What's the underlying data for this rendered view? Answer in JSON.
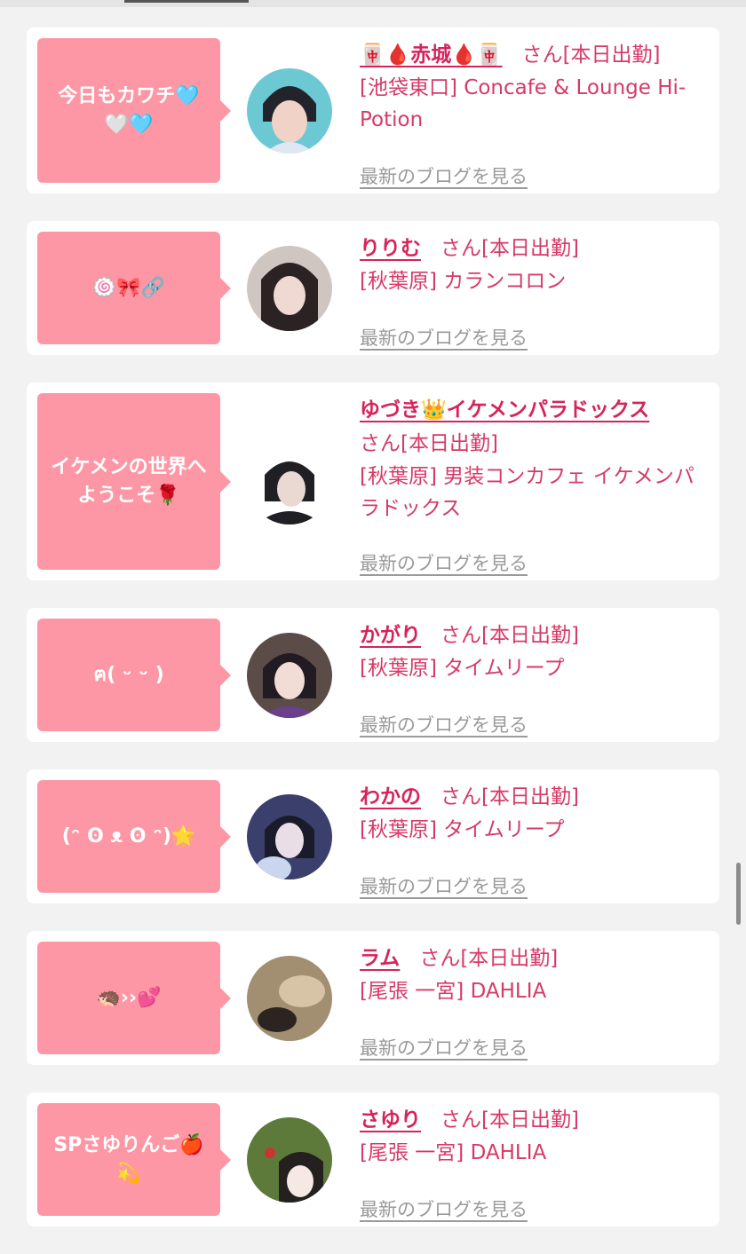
{
  "common": {
    "san_label": "さん[本日出勤]",
    "blog_link": "最新のブログを見る"
  },
  "cards": [
    {
      "bubble": "今日もカワチ🩵🤍🩵",
      "name": "🀄🩸赤城🩸🀄",
      "shop": "[池袋東口] Concafe & Lounge Hi-Potion",
      "avatar_colors": [
        "#6cc9d3",
        "#23232b",
        "#f1d2c6"
      ]
    },
    {
      "bubble": "🍥🎀🔗",
      "name": "りりむ",
      "shop": "[秋葉原] カランコロン",
      "avatar_colors": [
        "#cfc6c2",
        "#2b2224",
        "#f0d9d3"
      ]
    },
    {
      "bubble": "イケメンの世界へようこそ🌹",
      "name": "ゆづき👑イケメンパラドックス",
      "shop": "[秋葉原] 男装コンカフェ イケメンパラドックス",
      "avatar_colors": [
        "#ffffff",
        "#1f1f24",
        "#e9d9d2"
      ]
    },
    {
      "bubble": "ฅ( ᵕ ᵕ )",
      "name": "かがり",
      "shop": "[秋葉原] タイムリープ",
      "avatar_colors": [
        "#5b4c48",
        "#221b22",
        "#f2dcd6"
      ]
    },
    {
      "bubble": "(ᵔ ʘ ᴥ ʘ ᵔ)🌟",
      "name": "わかの",
      "shop": "[秋葉原] タイムリープ",
      "avatar_colors": [
        "#3b3f6c",
        "#1a1b2a",
        "#e9dde6"
      ]
    },
    {
      "bubble": "🦔››💕",
      "name": "ラム",
      "shop": "[尾張 一宮] DAHLIA",
      "avatar_colors": [
        "#a28e70",
        "#2c2420",
        "#d7c3a6"
      ]
    },
    {
      "bubble": "SPさゆりんご🍎💫",
      "name": "さゆり",
      "shop": "[尾張 一宮] DAHLIA",
      "avatar_colors": [
        "#5d7a3a",
        "#242020",
        "#f6e8e2"
      ]
    }
  ]
}
